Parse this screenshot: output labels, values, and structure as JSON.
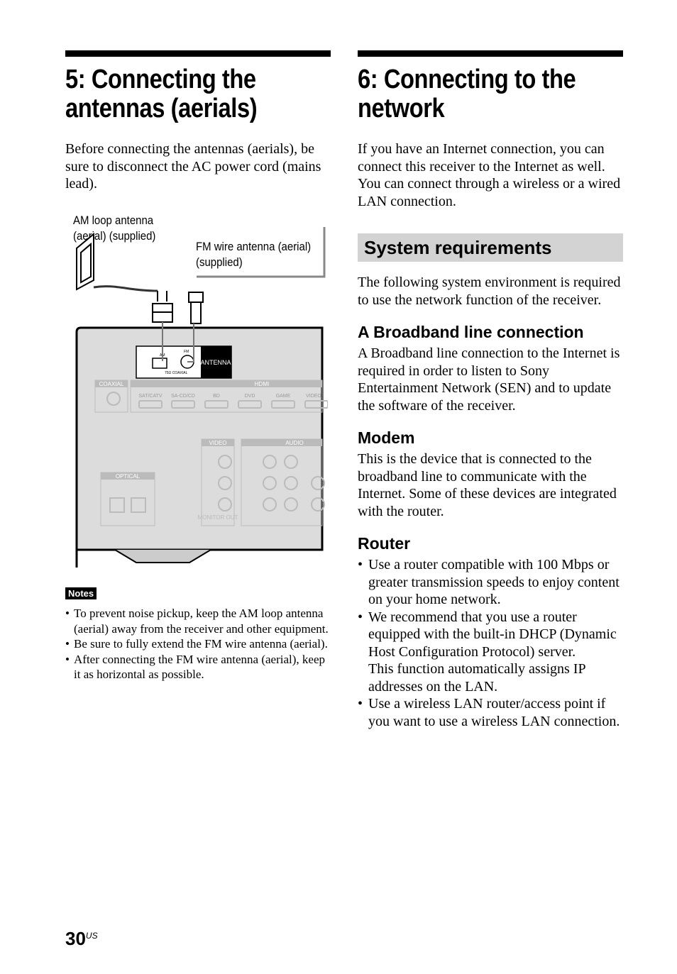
{
  "left": {
    "title": "5: Connecting the antennas (aerials)",
    "intro": "Before connecting the antennas (aerials), be sure to disconnect the AC power cord (mains lead).",
    "diagram": {
      "am_label": "AM loop antenna (aerial) (supplied)",
      "fm_label": "FM wire antenna (aerial) (supplied)",
      "antenna": "ANTENNA",
      "fm": "FM",
      "am": "AM",
      "coax75": "75Ω COAXIAL",
      "coaxial": "COAXIAL",
      "hdmi": "HDMI",
      "video": "VIDEO",
      "audio": "AUDIO",
      "optical": "OPTICAL",
      "monitor_out": "MONITOR OUT",
      "hdmi_inputs": [
        "SAT/CATV",
        "SA-CD/CD",
        "BD",
        "DVD",
        "GAME",
        "VIDEO"
      ]
    },
    "notes_label": "Notes",
    "notes": [
      "To prevent noise pickup, keep the AM loop antenna (aerial) away from the receiver and other equipment.",
      "Be sure to fully extend the FM wire antenna (aerial).",
      "After connecting the FM wire antenna (aerial), keep it as horizontal as possible."
    ]
  },
  "right": {
    "title": "6: Connecting to the network",
    "intro": "If you have an Internet connection, you can connect this receiver to the Internet as well. You can connect through a wireless or a wired LAN connection.",
    "section": "System requirements",
    "section_intro": "The following system environment is required to use the network function of the receiver.",
    "broadband": {
      "heading": "A Broadband line connection",
      "text": "A Broadband line connection to the Internet is required in order to listen to Sony Entertainment Network (SEN) and to update the software of the receiver."
    },
    "modem": {
      "heading": "Modem",
      "text": "This is the device that is connected to the broadband line to communicate with the Internet. Some of these devices are integrated with the router."
    },
    "router": {
      "heading": "Router",
      "items": [
        "Use a router compatible with 100 Mbps or greater transmission speeds to enjoy content on your home network.",
        "We recommend that you use a router equipped with the built-in DHCP (Dynamic Host Configuration Protocol) server.",
        "Use a wireless LAN router/access point if you want to use a wireless LAN connection."
      ],
      "item2_extra": "This function automatically assigns IP addresses on the LAN."
    }
  },
  "page": {
    "number": "30",
    "suffix": "US"
  }
}
